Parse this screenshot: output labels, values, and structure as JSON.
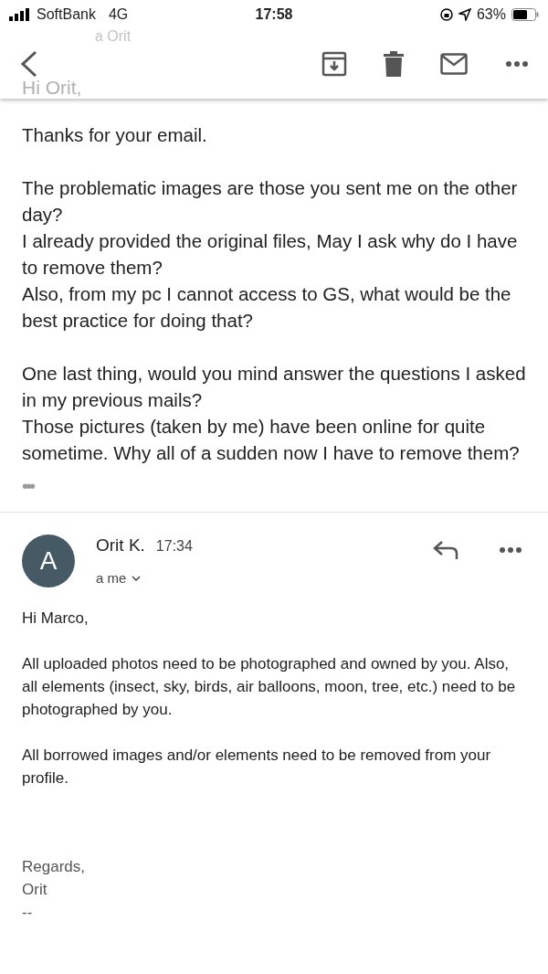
{
  "status_bar": {
    "carrier": "SoftBank",
    "network": "4G",
    "time": "17:58",
    "battery": "63%"
  },
  "behind_header": {
    "recipient": "a Orit",
    "greeting": "Hi Orit,"
  },
  "messages": [
    {
      "kind": "body",
      "paragraphs": [
        [
          "Thanks for your email."
        ],
        [
          "The problematic images are those you sent me on the other day?",
          "I already provided the original files, May I ask why do I have to remove them?",
          "Also, from my pc I cannot access to GS, what would be the best practice for doing that?"
        ],
        [
          "One last thing, would you mind answer the questions I asked in my previous mails?",
          "Those pictures (taken by me) have been online for quite sometime. Why all of a sudden now I have to remove them?"
        ]
      ],
      "trimmed": "•••"
    },
    {
      "kind": "full",
      "avatar": "A",
      "sender": "Orit K.",
      "time": "17:34",
      "recipient": "a me",
      "paragraphs": [
        [
          "Hi Marco,"
        ],
        [
          "All uploaded photos need to be photographed and owned by you. Also, all elements (insect, sky, birds, air balloons, moon, tree, etc.) need to be photographed by you."
        ],
        [
          "All borrowed images and/or elements need to be removed from your profile."
        ]
      ],
      "signature": [
        "Regards,",
        "Orit",
        "--"
      ]
    }
  ]
}
